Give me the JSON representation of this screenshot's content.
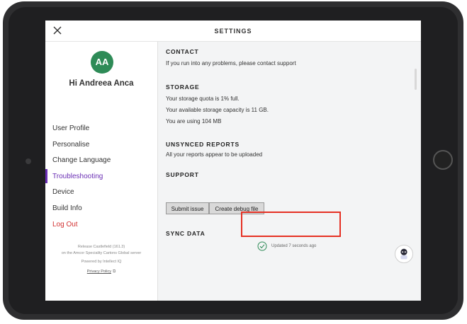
{
  "header": {
    "title": "SETTINGS",
    "close_icon": "close-icon"
  },
  "sidebar": {
    "avatar_initials": "AA",
    "avatar_color": "#2e8b57",
    "greeting": "Hi Andreea Anca",
    "items": [
      {
        "label": "User Profile",
        "state": "normal"
      },
      {
        "label": "Personalise",
        "state": "normal"
      },
      {
        "label": "Change Language",
        "state": "normal"
      },
      {
        "label": "Troubleshooting",
        "state": "active"
      },
      {
        "label": "Device",
        "state": "normal"
      },
      {
        "label": "Build Info",
        "state": "normal"
      },
      {
        "label": "Log Out",
        "state": "danger"
      }
    ],
    "release_line1": "Release Castlefield (161.3)",
    "release_line2": "on the Amcor Speciality Cartons Global server",
    "powered_by": "Powered by Intellect IQ",
    "privacy_link": "Privacy Policy"
  },
  "content": {
    "contact": {
      "title": "CONTACT",
      "text": "If you run into any problems, please contact support"
    },
    "storage": {
      "title": "STORAGE",
      "lines": [
        "Your storage quota is 1% full.",
        "Your available storage capacity is 11 GB.",
        "You are using 104 MB"
      ]
    },
    "unsynced": {
      "title": "UNSYNCED REPORTS",
      "text": "All your reports appear to be uploaded"
    },
    "support": {
      "title": "SUPPORT",
      "submit_label": "Submit issue",
      "debug_label": "Create debug file"
    },
    "sync": {
      "title": "SYNC DATA",
      "status": "Updated 7 seconds ago"
    }
  },
  "colors": {
    "accent": "#6a2eb4",
    "danger": "#d23232",
    "highlight": "#e53023",
    "success": "#2e8b57"
  }
}
